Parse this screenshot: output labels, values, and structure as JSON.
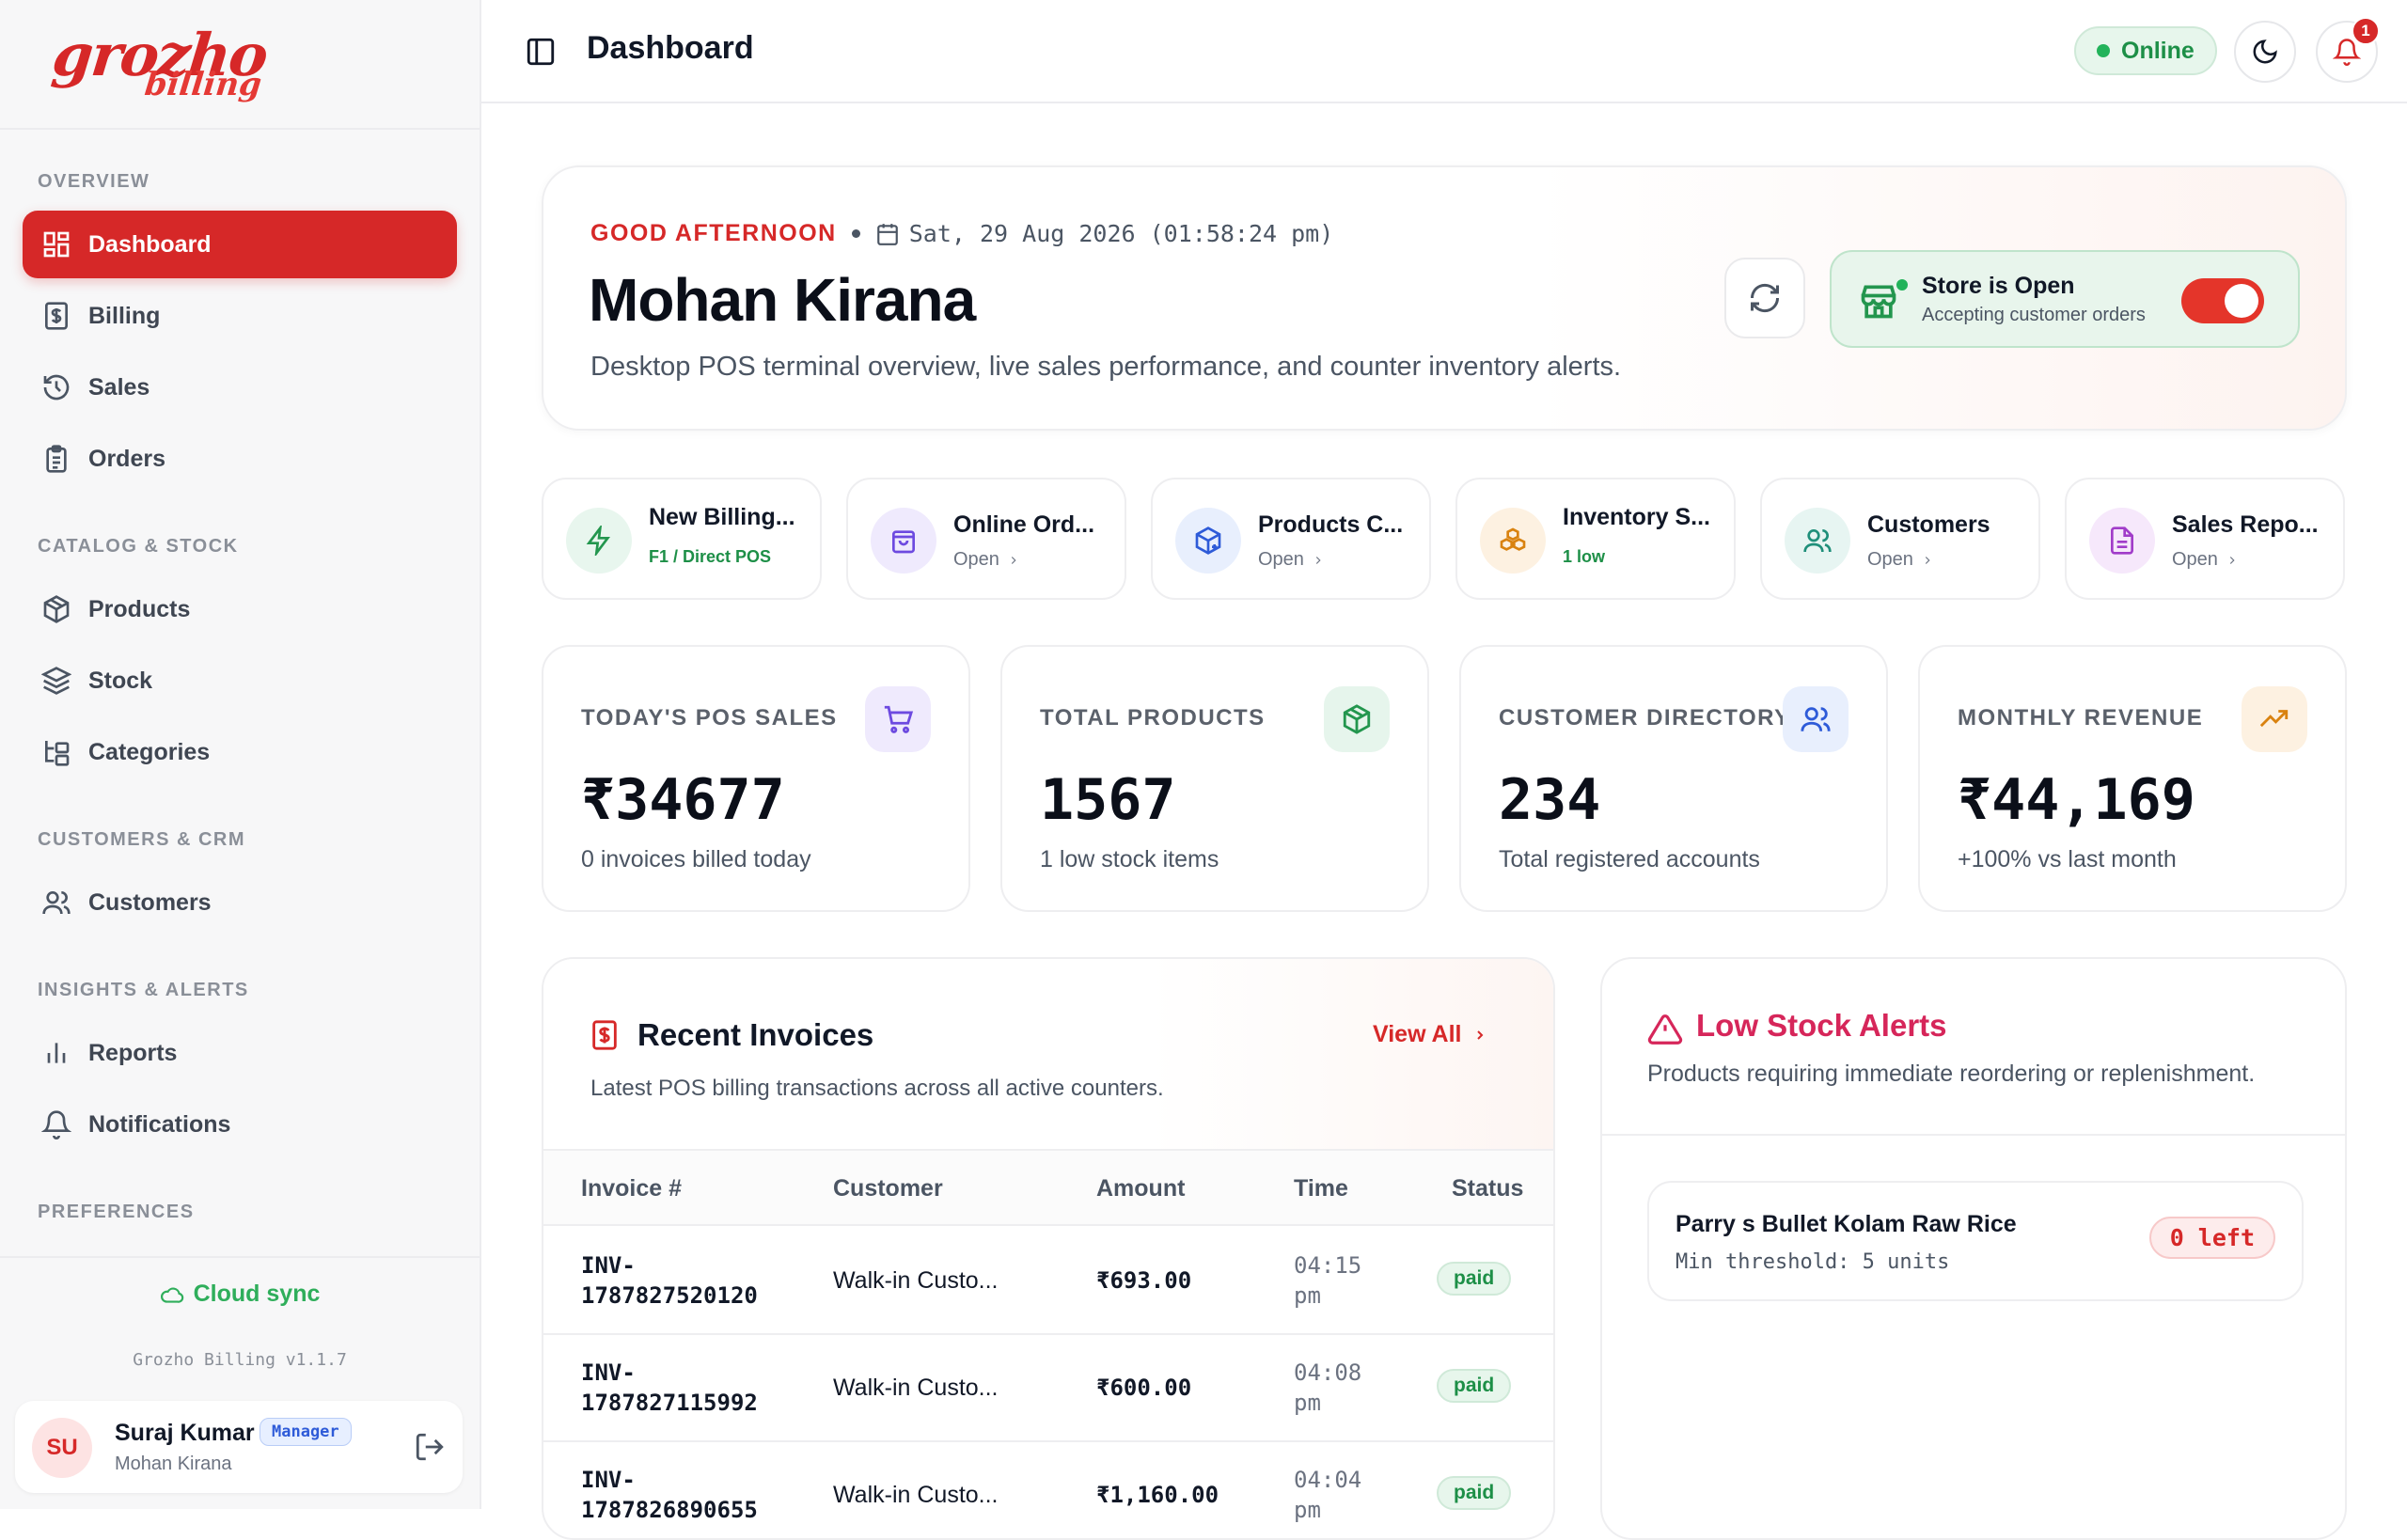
{
  "brand": {
    "logo_main": "grozho",
    "logo_sub": "billing",
    "accent": "#d62828"
  },
  "sidebar": {
    "sections": [
      "OVERVIEW",
      "CATALOG & STOCK",
      "CUSTOMERS & CRM",
      "INSIGHTS & ALERTS",
      "PREFERENCES"
    ],
    "items": [
      {
        "label": "Dashboard",
        "icon": "dashboard-icon"
      },
      {
        "label": "Billing",
        "icon": "receipt-icon"
      },
      {
        "label": "Sales",
        "icon": "history-icon"
      },
      {
        "label": "Orders",
        "icon": "clipboard-icon"
      },
      {
        "label": "Products",
        "icon": "package-icon"
      },
      {
        "label": "Stock",
        "icon": "layers-icon"
      },
      {
        "label": "Categories",
        "icon": "folder-tree-icon"
      },
      {
        "label": "Customers",
        "icon": "users-icon"
      },
      {
        "label": "Reports",
        "icon": "bar-chart-icon"
      },
      {
        "label": "Notifications",
        "icon": "bell-icon"
      }
    ],
    "cloud_sync": "Cloud sync",
    "version": "Grozho Billing v1.1.7",
    "user": {
      "initials": "SU",
      "name": "Suraj Kumar",
      "role": "Manager",
      "store": "Mohan Kirana"
    }
  },
  "header": {
    "title": "Dashboard",
    "status": "Online",
    "notification_count": "1"
  },
  "hero": {
    "greeting": "GOOD AFTERNOON",
    "datetime": "Sat, 29 Aug 2026 (01:58:24 pm)",
    "store_name": "Mohan Kirana",
    "subtitle": "Desktop POS terminal overview, live sales performance, and counter inventory alerts.",
    "store_status_title": "Store is Open",
    "store_status_sub": "Accepting customer orders",
    "store_open": true
  },
  "quick_actions": [
    {
      "title": "New Billing...",
      "sub": "F1 / Direct POS",
      "icon": "zap-icon"
    },
    {
      "title": "Online Ord...",
      "sub": "Open",
      "icon": "shopping-bag-icon"
    },
    {
      "title": "Products C...",
      "sub": "Open",
      "icon": "package-plus-icon"
    },
    {
      "title": "Inventory S...",
      "sub": "1 low",
      "icon": "boxes-icon"
    },
    {
      "title": "Customers",
      "sub": "Open",
      "icon": "users-icon"
    },
    {
      "title": "Sales Repo...",
      "sub": "Open",
      "icon": "file-text-icon"
    }
  ],
  "stats": [
    {
      "label": "TODAY'S POS SALES",
      "value": "₹34677",
      "sub": "0 invoices billed today",
      "icon": "cart-icon"
    },
    {
      "label": "TOTAL PRODUCTS",
      "value": "1567",
      "sub": "1 low stock items",
      "icon": "package-icon"
    },
    {
      "label": "CUSTOMER DIRECTORY",
      "value": "234",
      "sub": "Total registered accounts",
      "icon": "users-icon"
    },
    {
      "label": "MONTHLY REVENUE",
      "value": "₹44,169",
      "sub": "+100% vs last month",
      "icon": "trending-up-icon"
    }
  ],
  "invoices": {
    "title": "Recent Invoices",
    "subtitle": "Latest POS billing transactions across all active counters.",
    "view_all": "View All",
    "columns": [
      "Invoice #",
      "Customer",
      "Amount",
      "Time",
      "Status"
    ],
    "rows": [
      {
        "id_a": "INV-",
        "id_b": "1787827520120",
        "customer": "Walk-in Custo...",
        "amount": "₹693.00",
        "time_a": "04:15",
        "time_b": "pm",
        "status": "paid"
      },
      {
        "id_a": "INV-",
        "id_b": "1787827115992",
        "customer": "Walk-in Custo...",
        "amount": "₹600.00",
        "time_a": "04:08",
        "time_b": "pm",
        "status": "paid"
      },
      {
        "id_a": "INV-",
        "id_b": "1787826890655",
        "customer": "Walk-in Custo...",
        "amount": "₹1,160.00",
        "time_a": "04:04",
        "time_b": "pm",
        "status": "paid"
      }
    ]
  },
  "low_stock": {
    "title": "Low Stock Alerts",
    "subtitle": "Products requiring immediate reordering or replenishment.",
    "items": [
      {
        "name": "Parry s Bullet Kolam Raw Rice",
        "threshold": "Min threshold: 5 units",
        "left": "0 left"
      }
    ]
  }
}
